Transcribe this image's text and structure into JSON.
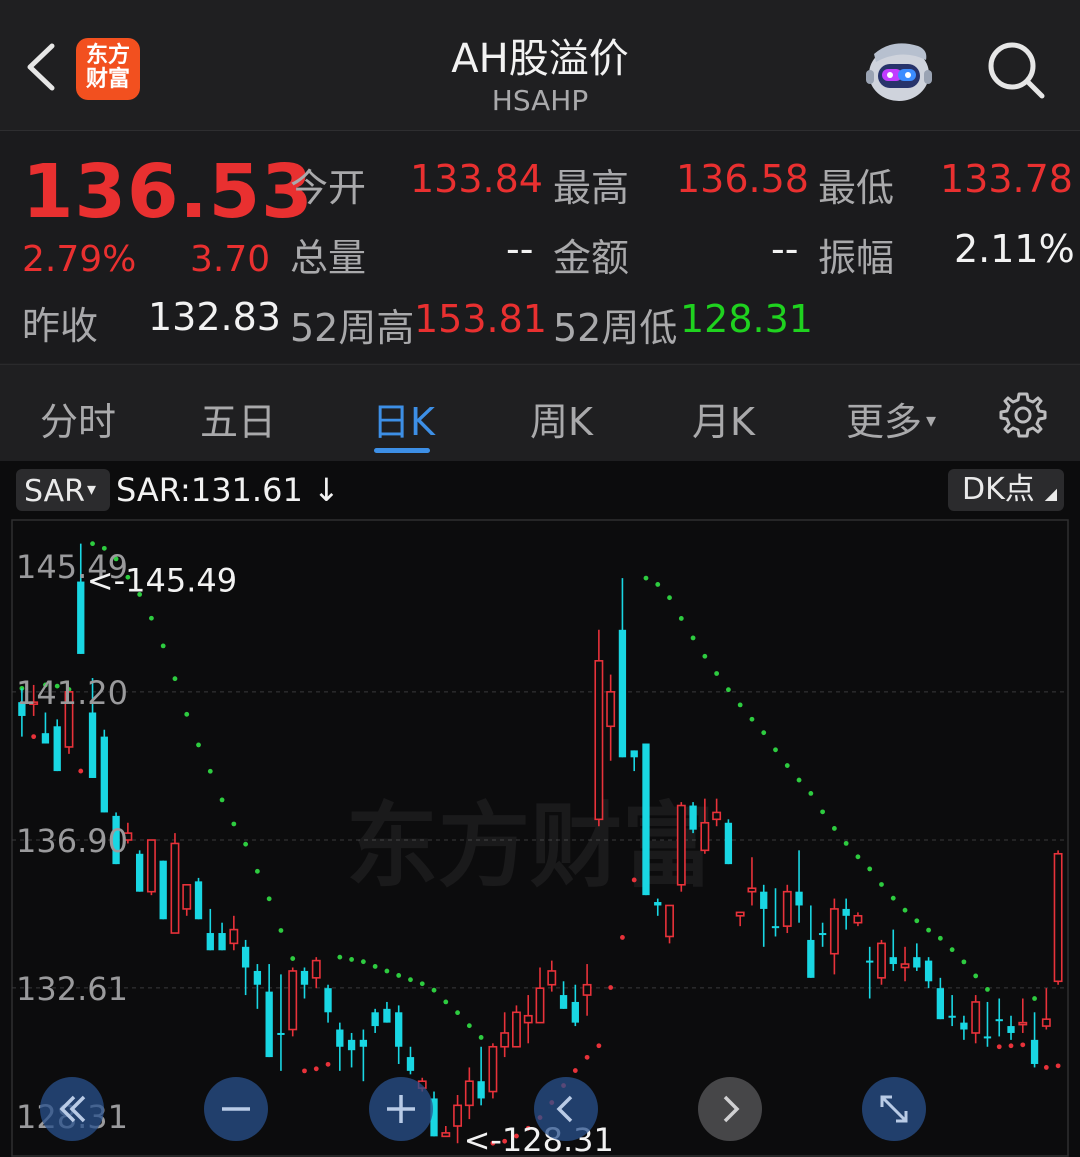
{
  "header": {
    "title": "AH股溢价",
    "subtitle": "HSAHP",
    "logo_text_line1": "东方",
    "logo_text_line2": "财富"
  },
  "quote": {
    "price": "136.53",
    "change_pct": "2.79%",
    "change": "3.70",
    "open_label": "今开",
    "open": "133.84",
    "high_label": "最高",
    "high": "136.58",
    "low_label": "最低",
    "low": "133.78",
    "volume_label": "总量",
    "volume": "--",
    "amount_label": "金额",
    "amount": "--",
    "amplitude_label": "振幅",
    "amplitude": "2.11%",
    "prev_close_label": "昨收",
    "prev_close": "132.83",
    "week52_high_label": "52周高",
    "week52_high": "153.81",
    "week52_low_label": "52周低",
    "week52_low": "128.31"
  },
  "tabs": [
    "分时",
    "五日",
    "日K",
    "周K",
    "月K",
    "更多"
  ],
  "active_tab": "日K",
  "chart_toolbar": {
    "indicator": "SAR",
    "sar_readout": "SAR:131.61 ↓",
    "dk_label": "DK点"
  },
  "chart_data": {
    "type": "candlestick",
    "y_ticks": [
      "145.49",
      "141.20",
      "136.90",
      "132.61",
      "128.31"
    ],
    "ylim": [
      128.31,
      145.49
    ],
    "max_marker": "<-145.49",
    "min_marker": "<-128.31",
    "watermark": "东方财富",
    "colors": {
      "up": "#e8323a",
      "down": "#19d7e3",
      "sar_up": "#e8323a",
      "sar_down": "#2ecc40"
    },
    "candles": [
      {
        "o": 140.9,
        "h": 141.3,
        "l": 139.9,
        "c": 140.5,
        "d": -1
      },
      {
        "o": 140.9,
        "h": 141.4,
        "l": 140.5,
        "c": 140.9,
        "d": 1
      },
      {
        "o": 140.0,
        "h": 140.6,
        "l": 139.7,
        "c": 139.7,
        "d": -1
      },
      {
        "o": 140.2,
        "h": 140.4,
        "l": 138.9,
        "c": 138.9,
        "d": -1
      },
      {
        "o": 139.6,
        "h": 141.2,
        "l": 139.4,
        "c": 141.2,
        "d": 1
      },
      {
        "o": 144.4,
        "h": 145.5,
        "l": 142.3,
        "c": 142.3,
        "d": -1
      },
      {
        "o": 140.6,
        "h": 141.6,
        "l": 138.7,
        "c": 138.7,
        "d": -1
      },
      {
        "o": 139.9,
        "h": 140.1,
        "l": 137.7,
        "c": 137.7,
        "d": -1
      },
      {
        "o": 137.6,
        "h": 137.7,
        "l": 136.2,
        "c": 136.2,
        "d": -1
      },
      {
        "o": 136.9,
        "h": 137.4,
        "l": 136.8,
        "c": 137.1,
        "d": 1
      },
      {
        "o": 136.5,
        "h": 136.6,
        "l": 135.4,
        "c": 135.4,
        "d": -1
      },
      {
        "o": 135.4,
        "h": 136.9,
        "l": 135.3,
        "c": 136.9,
        "d": 1
      },
      {
        "o": 136.3,
        "h": 136.3,
        "l": 134.6,
        "c": 134.6,
        "d": -1
      },
      {
        "o": 134.2,
        "h": 137.1,
        "l": 134.2,
        "c": 136.8,
        "d": 1
      },
      {
        "o": 134.9,
        "h": 135.6,
        "l": 134.7,
        "c": 135.6,
        "d": 1
      },
      {
        "o": 135.7,
        "h": 135.8,
        "l": 134.6,
        "c": 134.6,
        "d": -1
      },
      {
        "o": 134.2,
        "h": 134.9,
        "l": 133.7,
        "c": 133.7,
        "d": -1
      },
      {
        "o": 134.2,
        "h": 134.5,
        "l": 133.7,
        "c": 133.7,
        "d": -1
      },
      {
        "o": 133.9,
        "h": 134.7,
        "l": 133.7,
        "c": 134.3,
        "d": 1
      },
      {
        "o": 133.8,
        "h": 134.0,
        "l": 132.4,
        "c": 133.2,
        "d": -1
      },
      {
        "o": 133.1,
        "h": 133.3,
        "l": 132.0,
        "c": 132.7,
        "d": -1
      },
      {
        "o": 132.5,
        "h": 133.3,
        "l": 130.6,
        "c": 130.6,
        "d": -1
      },
      {
        "o": 131.3,
        "h": 133.0,
        "l": 130.2,
        "c": 131.3,
        "d": -1
      },
      {
        "o": 131.4,
        "h": 133.2,
        "l": 131.2,
        "c": 133.1,
        "d": 1
      },
      {
        "o": 133.1,
        "h": 133.2,
        "l": 132.3,
        "c": 132.7,
        "d": -1
      },
      {
        "o": 132.9,
        "h": 133.5,
        "l": 132.6,
        "c": 133.4,
        "d": 1
      },
      {
        "o": 132.6,
        "h": 132.7,
        "l": 131.6,
        "c": 131.9,
        "d": -1
      },
      {
        "o": 131.4,
        "h": 131.6,
        "l": 130.2,
        "c": 130.9,
        "d": -1
      },
      {
        "o": 131.1,
        "h": 131.3,
        "l": 130.3,
        "c": 130.8,
        "d": -1
      },
      {
        "o": 131.1,
        "h": 131.4,
        "l": 129.9,
        "c": 130.9,
        "d": -1
      },
      {
        "o": 131.9,
        "h": 132.0,
        "l": 131.3,
        "c": 131.5,
        "d": -1
      },
      {
        "o": 132.0,
        "h": 132.2,
        "l": 131.6,
        "c": 131.6,
        "d": -1
      },
      {
        "o": 131.9,
        "h": 132.1,
        "l": 130.4,
        "c": 130.9,
        "d": -1
      },
      {
        "o": 130.6,
        "h": 130.9,
        "l": 130.1,
        "c": 130.2,
        "d": -1
      },
      {
        "o": 129.7,
        "h": 130.0,
        "l": 129.6,
        "c": 129.9,
        "d": 1
      },
      {
        "o": 129.4,
        "h": 129.6,
        "l": 128.3,
        "c": 128.3,
        "d": -1
      },
      {
        "o": 128.3,
        "h": 128.6,
        "l": 128.3,
        "c": 128.4,
        "d": 1
      },
      {
        "o": 128.6,
        "h": 129.5,
        "l": 128.1,
        "c": 129.2,
        "d": 1
      },
      {
        "o": 129.2,
        "h": 130.3,
        "l": 128.8,
        "c": 129.9,
        "d": 1
      },
      {
        "o": 129.9,
        "h": 130.9,
        "l": 129.2,
        "c": 129.4,
        "d": -1
      },
      {
        "o": 129.6,
        "h": 131.0,
        "l": 129.4,
        "c": 130.9,
        "d": 1
      },
      {
        "o": 130.9,
        "h": 131.9,
        "l": 130.6,
        "c": 131.3,
        "d": 1
      },
      {
        "o": 130.9,
        "h": 132.1,
        "l": 130.9,
        "c": 131.9,
        "d": 1
      },
      {
        "o": 131.8,
        "h": 132.4,
        "l": 131.0,
        "c": 131.6,
        "d": 1
      },
      {
        "o": 131.6,
        "h": 133.2,
        "l": 131.6,
        "c": 132.6,
        "d": 1
      },
      {
        "o": 132.7,
        "h": 133.4,
        "l": 132.5,
        "c": 133.1,
        "d": 1
      },
      {
        "o": 132.4,
        "h": 132.8,
        "l": 132.0,
        "c": 132.0,
        "d": -1
      },
      {
        "o": 132.2,
        "h": 132.7,
        "l": 131.5,
        "c": 131.6,
        "d": -1
      },
      {
        "o": 132.4,
        "h": 133.3,
        "l": 131.8,
        "c": 132.7,
        "d": 1
      },
      {
        "o": 137.5,
        "h": 143.0,
        "l": 137.3,
        "c": 142.1,
        "d": 1
      },
      {
        "o": 140.2,
        "h": 141.7,
        "l": 139.2,
        "c": 141.2,
        "d": 1
      },
      {
        "o": 143.0,
        "h": 144.5,
        "l": 139.3,
        "c": 139.3,
        "d": -1
      },
      {
        "o": 139.5,
        "h": 139.5,
        "l": 138.9,
        "c": 139.3,
        "d": -1
      },
      {
        "o": 139.7,
        "h": 139.7,
        "l": 135.3,
        "c": 135.3,
        "d": -1
      },
      {
        "o": 135.1,
        "h": 135.2,
        "l": 134.7,
        "c": 135.0,
        "d": -1
      },
      {
        "o": 134.1,
        "h": 135.0,
        "l": 133.9,
        "c": 135.0,
        "d": 1
      },
      {
        "o": 135.6,
        "h": 138.0,
        "l": 135.4,
        "c": 137.9,
        "d": 1
      },
      {
        "o": 137.9,
        "h": 138.0,
        "l": 137.1,
        "c": 137.2,
        "d": -1
      },
      {
        "o": 136.6,
        "h": 138.1,
        "l": 136.5,
        "c": 137.4,
        "d": 1
      },
      {
        "o": 137.7,
        "h": 138.1,
        "l": 137.3,
        "c": 137.5,
        "d": 1
      },
      {
        "o": 137.4,
        "h": 137.5,
        "l": 136.2,
        "c": 136.2,
        "d": -1
      },
      {
        "o": 134.7,
        "h": 134.8,
        "l": 134.4,
        "c": 134.8,
        "d": 1
      },
      {
        "o": 135.5,
        "h": 136.4,
        "l": 135.0,
        "c": 135.4,
        "d": 1
      },
      {
        "o": 135.4,
        "h": 135.6,
        "l": 133.8,
        "c": 134.9,
        "d": -1
      },
      {
        "o": 134.4,
        "h": 135.5,
        "l": 134.1,
        "c": 134.4,
        "d": -1
      },
      {
        "o": 134.4,
        "h": 135.6,
        "l": 134.2,
        "c": 135.4,
        "d": 1
      },
      {
        "o": 135.4,
        "h": 136.6,
        "l": 134.5,
        "c": 135.0,
        "d": -1
      },
      {
        "o": 134.0,
        "h": 135.0,
        "l": 132.9,
        "c": 132.9,
        "d": -1
      },
      {
        "o": 134.2,
        "h": 134.5,
        "l": 133.8,
        "c": 134.2,
        "d": -1
      },
      {
        "o": 133.6,
        "h": 135.2,
        "l": 133.0,
        "c": 134.9,
        "d": 1
      },
      {
        "o": 134.9,
        "h": 135.2,
        "l": 134.3,
        "c": 134.7,
        "d": -1
      },
      {
        "o": 134.7,
        "h": 134.8,
        "l": 134.4,
        "c": 134.5,
        "d": 1
      },
      {
        "o": 133.4,
        "h": 133.8,
        "l": 132.3,
        "c": 133.4,
        "d": -1
      },
      {
        "o": 132.9,
        "h": 134.0,
        "l": 132.7,
        "c": 133.9,
        "d": 1
      },
      {
        "o": 133.3,
        "h": 134.3,
        "l": 133.1,
        "c": 133.5,
        "d": -1
      },
      {
        "o": 133.2,
        "h": 133.8,
        "l": 132.8,
        "c": 133.3,
        "d": 1
      },
      {
        "o": 133.5,
        "h": 133.9,
        "l": 133.1,
        "c": 133.2,
        "d": -1
      },
      {
        "o": 133.4,
        "h": 133.5,
        "l": 132.6,
        "c": 132.8,
        "d": -1
      },
      {
        "o": 132.6,
        "h": 132.9,
        "l": 131.7,
        "c": 131.7,
        "d": -1
      },
      {
        "o": 131.8,
        "h": 132.4,
        "l": 131.5,
        "c": 131.8,
        "d": -1
      },
      {
        "o": 131.6,
        "h": 131.8,
        "l": 131.1,
        "c": 131.4,
        "d": -1
      },
      {
        "o": 131.3,
        "h": 132.4,
        "l": 131.0,
        "c": 132.2,
        "d": 1
      },
      {
        "o": 131.2,
        "h": 132.2,
        "l": 130.9,
        "c": 131.2,
        "d": -1
      },
      {
        "o": 131.7,
        "h": 132.3,
        "l": 131.2,
        "c": 131.7,
        "d": -1
      },
      {
        "o": 131.5,
        "h": 131.8,
        "l": 131.1,
        "c": 131.3,
        "d": -1
      },
      {
        "o": 131.6,
        "h": 132.3,
        "l": 131.3,
        "c": 131.6,
        "d": 1
      },
      {
        "o": 131.1,
        "h": 131.9,
        "l": 130.3,
        "c": 130.4,
        "d": -1
      },
      {
        "o": 131.5,
        "h": 132.6,
        "l": 131.4,
        "c": 131.7,
        "d": 1
      },
      {
        "o": 132.8,
        "h": 136.6,
        "l": 132.7,
        "c": 136.5,
        "d": 1
      }
    ]
  }
}
